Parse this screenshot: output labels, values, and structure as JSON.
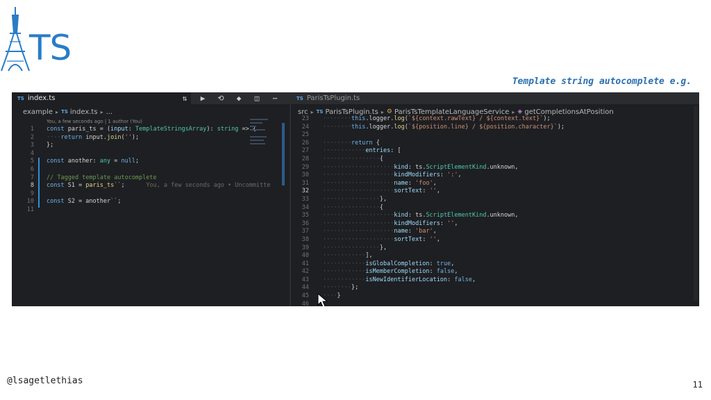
{
  "slide": {
    "logo_text": "TS",
    "caption": "Template string autocomplete e.g.",
    "author_handle": "@lsagetlethias",
    "page_number": "11"
  },
  "left_pane": {
    "tab_badge": "TS",
    "tab_label": "index.ts",
    "breadcrumb": [
      "example",
      "index.ts",
      "..."
    ],
    "blame_header": "You, a few seconds ago | 1 author (You)",
    "toolbar_icons": [
      "git-compare-icon",
      "play-icon",
      "go-to-icon",
      "source-control-icon",
      "split-editor-icon",
      "more-icon"
    ],
    "lines": [
      {
        "n": "1",
        "segments": [
          [
            "kw",
            "const "
          ],
          [
            "",
            "paris_ts = ("
          ],
          [
            "prop",
            "input"
          ],
          [
            "",
            ": "
          ],
          [
            "ty",
            "TemplateStringsArray"
          ],
          [
            "",
            "): "
          ],
          [
            "ty",
            "string"
          ],
          [
            "",
            " => {"
          ]
        ]
      },
      {
        "n": "2",
        "segments": [
          [
            "dots",
            "····"
          ],
          [
            "kw",
            "return "
          ],
          [
            "",
            "input."
          ],
          [
            "fn",
            "join"
          ],
          [
            "",
            "("
          ],
          [
            "str",
            "''"
          ],
          [
            "",
            ");"
          ]
        ]
      },
      {
        "n": "3",
        "segments": [
          [
            "",
            "};"
          ]
        ]
      },
      {
        "n": "4",
        "segments": []
      },
      {
        "n": "5",
        "segments": [
          [
            "kw",
            "const "
          ],
          [
            "",
            "another: "
          ],
          [
            "ty",
            "any"
          ],
          [
            "",
            " = "
          ],
          [
            "kw",
            "null"
          ],
          [
            "",
            ";"
          ]
        ]
      },
      {
        "n": "6",
        "segments": []
      },
      {
        "n": "7",
        "segments": [
          [
            "cm",
            "// Tagged template autocomplete"
          ]
        ]
      },
      {
        "n": "8",
        "segments": [
          [
            "kw",
            "const "
          ],
          [
            "",
            "S1 = "
          ],
          [
            "fn",
            "paris_ts"
          ],
          [
            "str",
            "``"
          ],
          [
            "",
            ";"
          ],
          [
            "blame",
            "      You, a few seconds ago • Uncommitte"
          ]
        ]
      },
      {
        "n": "9",
        "segments": []
      },
      {
        "n": "10",
        "segments": [
          [
            "kw",
            "const "
          ],
          [
            "",
            "S2 = another"
          ],
          [
            "str",
            "``"
          ],
          [
            "",
            ";"
          ]
        ]
      },
      {
        "n": "11",
        "segments": []
      }
    ]
  },
  "right_pane": {
    "tab_badge": "TS",
    "tab_label": "ParisTsPlugin.ts",
    "breadcrumb": [
      "src",
      "ParisTsPlugin.ts",
      "ParisTsTemplateLanguageService",
      "getCompletionsAtPosition"
    ],
    "lines": [
      {
        "n": "23",
        "segments": [
          [
            "dots",
            "········"
          ],
          [
            "kw",
            "this"
          ],
          [
            "",
            ".logger."
          ],
          [
            "fn",
            "log"
          ],
          [
            "",
            "("
          ],
          [
            "str",
            "`${context.rawText} / ${context.text}`"
          ],
          [
            "",
            ");"
          ]
        ]
      },
      {
        "n": "24",
        "segments": [
          [
            "dots",
            "········"
          ],
          [
            "kw",
            "this"
          ],
          [
            "",
            ".logger."
          ],
          [
            "fn",
            "log"
          ],
          [
            "",
            "("
          ],
          [
            "str",
            "`${position.line} / ${position.character}`"
          ],
          [
            "",
            ");"
          ]
        ]
      },
      {
        "n": "25",
        "segments": []
      },
      {
        "n": "26",
        "segments": [
          [
            "dots",
            "········"
          ],
          [
            "kw",
            "return "
          ],
          [
            "",
            "{"
          ]
        ]
      },
      {
        "n": "27",
        "segments": [
          [
            "dots",
            "············"
          ],
          [
            "prop",
            "entries"
          ],
          [
            "",
            ": ["
          ]
        ]
      },
      {
        "n": "28",
        "segments": [
          [
            "dots",
            "················"
          ],
          [
            "",
            "{"
          ]
        ]
      },
      {
        "n": "29",
        "segments": [
          [
            "dots",
            "····················"
          ],
          [
            "prop",
            "kind"
          ],
          [
            "",
            ": ts."
          ],
          [
            "ty",
            "ScriptElementKind"
          ],
          [
            "",
            ".unknown,"
          ]
        ]
      },
      {
        "n": "30",
        "segments": [
          [
            "dots",
            "····················"
          ],
          [
            "prop",
            "kindModifiers"
          ],
          [
            "",
            ": "
          ],
          [
            "str",
            "':'"
          ],
          [
            "",
            ","
          ]
        ]
      },
      {
        "n": "31",
        "segments": [
          [
            "dots",
            "····················"
          ],
          [
            "prop",
            "name"
          ],
          [
            "",
            ": "
          ],
          [
            "str",
            "'foo'"
          ],
          [
            "",
            ","
          ]
        ]
      },
      {
        "n": "32",
        "segments": [
          [
            "dots",
            "····················"
          ],
          [
            "prop",
            "sortText"
          ],
          [
            "",
            ": "
          ],
          [
            "str",
            "''"
          ],
          [
            "",
            ","
          ]
        ]
      },
      {
        "n": "33",
        "segments": [
          [
            "dots",
            "················"
          ],
          [
            "",
            "},"
          ]
        ]
      },
      {
        "n": "34",
        "segments": [
          [
            "dots",
            "················"
          ],
          [
            "",
            "{"
          ]
        ]
      },
      {
        "n": "35",
        "segments": [
          [
            "dots",
            "····················"
          ],
          [
            "prop",
            "kind"
          ],
          [
            "",
            ": ts."
          ],
          [
            "ty",
            "ScriptElementKind"
          ],
          [
            "",
            ".unknown,"
          ]
        ]
      },
      {
        "n": "36",
        "segments": [
          [
            "dots",
            "····················"
          ],
          [
            "prop",
            "kindModifiers"
          ],
          [
            "",
            ": "
          ],
          [
            "str",
            "''"
          ],
          [
            "",
            ","
          ]
        ]
      },
      {
        "n": "37",
        "segments": [
          [
            "dots",
            "····················"
          ],
          [
            "prop",
            "name"
          ],
          [
            "",
            ": "
          ],
          [
            "str",
            "'bar'"
          ],
          [
            "",
            ","
          ]
        ]
      },
      {
        "n": "38",
        "segments": [
          [
            "dots",
            "····················"
          ],
          [
            "prop",
            "sortText"
          ],
          [
            "",
            ": "
          ],
          [
            "str",
            "''"
          ],
          [
            "",
            ","
          ]
        ]
      },
      {
        "n": "39",
        "segments": [
          [
            "dots",
            "················"
          ],
          [
            "",
            "},"
          ]
        ]
      },
      {
        "n": "40",
        "segments": [
          [
            "dots",
            "············"
          ],
          [
            "",
            "],"
          ]
        ]
      },
      {
        "n": "41",
        "segments": [
          [
            "dots",
            "············"
          ],
          [
            "prop",
            "isGlobalCompletion"
          ],
          [
            "",
            ": "
          ],
          [
            "kw",
            "true"
          ],
          [
            "",
            ","
          ]
        ]
      },
      {
        "n": "42",
        "segments": [
          [
            "dots",
            "············"
          ],
          [
            "prop",
            "isMemberCompletion"
          ],
          [
            "",
            ": "
          ],
          [
            "kw",
            "false"
          ],
          [
            "",
            ","
          ]
        ]
      },
      {
        "n": "43",
        "segments": [
          [
            "dots",
            "············"
          ],
          [
            "prop",
            "isNewIdentifierLocation"
          ],
          [
            "",
            ": "
          ],
          [
            "kw",
            "false"
          ],
          [
            "",
            ","
          ]
        ]
      },
      {
        "n": "44",
        "segments": [
          [
            "dots",
            "········"
          ],
          [
            "",
            "};"
          ]
        ]
      },
      {
        "n": "45",
        "segments": [
          [
            "dots",
            "····"
          ],
          [
            "",
            "}"
          ]
        ]
      },
      {
        "n": "46",
        "segments": []
      }
    ]
  },
  "colors": {
    "brand_blue": "#2a7cc7",
    "editor_bg": "#1e1f22",
    "keyword": "#6fb3e8",
    "string": "#ce9178"
  }
}
